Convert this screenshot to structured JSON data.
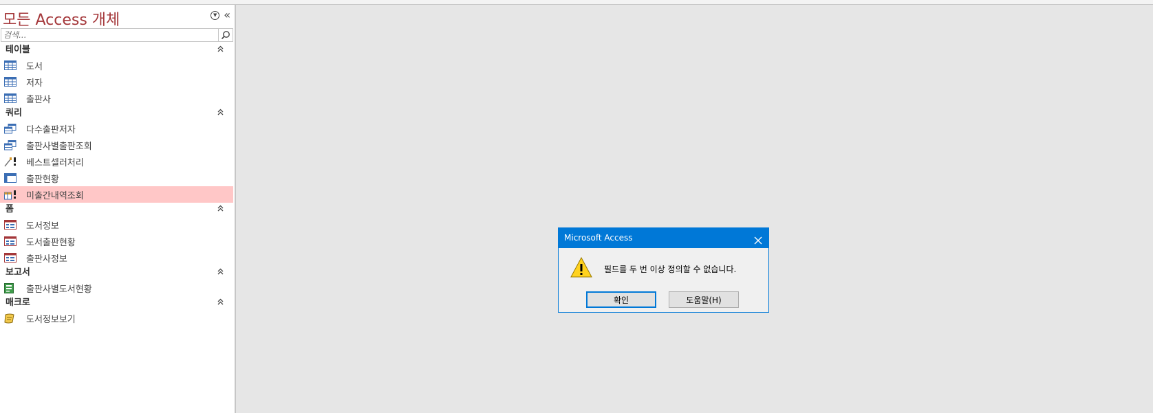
{
  "nav": {
    "title": "모든 Access 개체",
    "search_placeholder": "검색...",
    "groups": [
      {
        "label": "테이블",
        "items": [
          {
            "label": "도서",
            "icon": "table-icon"
          },
          {
            "label": "저자",
            "icon": "table-icon"
          },
          {
            "label": "출판사",
            "icon": "table-icon"
          }
        ]
      },
      {
        "label": "쿼리",
        "items": [
          {
            "label": "다수출판저자",
            "icon": "query-icon"
          },
          {
            "label": "출판사별출판조회",
            "icon": "query-icon"
          },
          {
            "label": "베스트셀러처리",
            "icon": "update-query-icon"
          },
          {
            "label": "출판현황",
            "icon": "crosstab-query-icon"
          },
          {
            "label": "미출간내역조회",
            "icon": "make-table-query-icon",
            "selected": true
          }
        ]
      },
      {
        "label": "폼",
        "items": [
          {
            "label": "도서정보",
            "icon": "form-icon"
          },
          {
            "label": "도서출판현황",
            "icon": "form-icon"
          },
          {
            "label": "출판사정보",
            "icon": "form-icon"
          }
        ]
      },
      {
        "label": "보고서",
        "items": [
          {
            "label": "출판사별도서현황",
            "icon": "report-icon"
          }
        ]
      },
      {
        "label": "매크로",
        "items": [
          {
            "label": "도서정보보기",
            "icon": "macro-icon"
          }
        ]
      }
    ]
  },
  "dialog": {
    "title": "Microsoft Access",
    "message": "필드를 두 번 이상 정의할 수 없습니다.",
    "ok_label": "확인",
    "help_label": "도움말(H)"
  },
  "colors": {
    "title_red": "#a4373a",
    "selected_bg": "#ffc7c7",
    "dialog_blue": "#0078d7",
    "workspace_bg": "#e6e6e6"
  }
}
